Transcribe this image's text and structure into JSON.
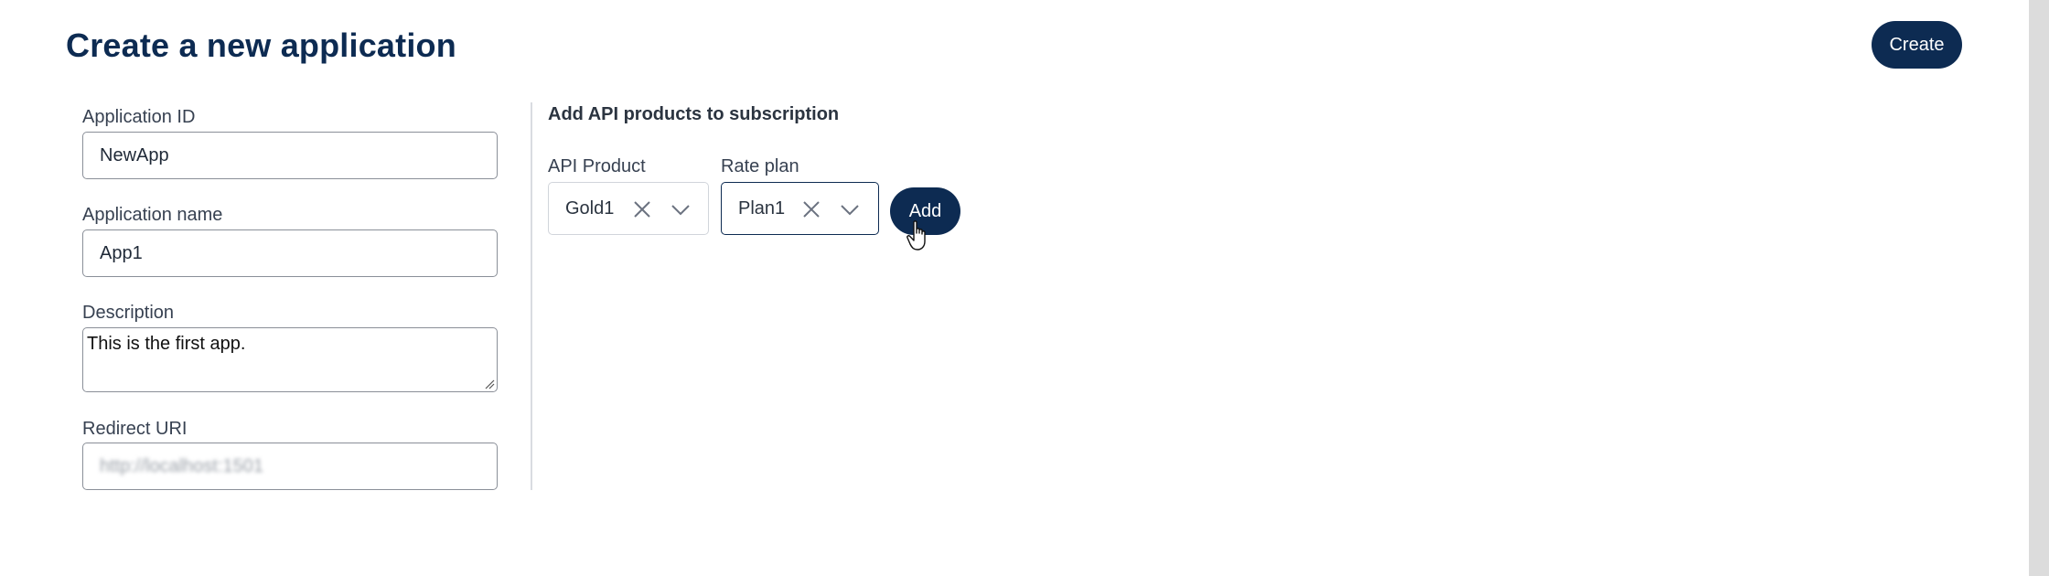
{
  "header": {
    "title": "Create a new application",
    "create_label": "Create"
  },
  "form": {
    "application_id": {
      "label": "Application ID",
      "value": "NewApp"
    },
    "application_name": {
      "label": "Application name",
      "value": "App1"
    },
    "description": {
      "label": "Description",
      "value": "This is the first app."
    },
    "redirect_uri": {
      "label": "Redirect URI",
      "value": "http://localhost:1501"
    }
  },
  "subscription": {
    "title": "Add API products to subscription",
    "api_product": {
      "label": "API Product",
      "value": "Gold1"
    },
    "rate_plan": {
      "label": "Rate plan",
      "value": "Plan1"
    },
    "add_label": "Add"
  },
  "icons": {
    "clear": "close-icon",
    "dropdown": "chevron-down-icon",
    "cursor": "hand-pointer-icon",
    "resize": "resize-grip-icon"
  },
  "colors": {
    "brand": "#0d2b52",
    "border": "#8a8f98",
    "divider": "#d9dce1"
  }
}
